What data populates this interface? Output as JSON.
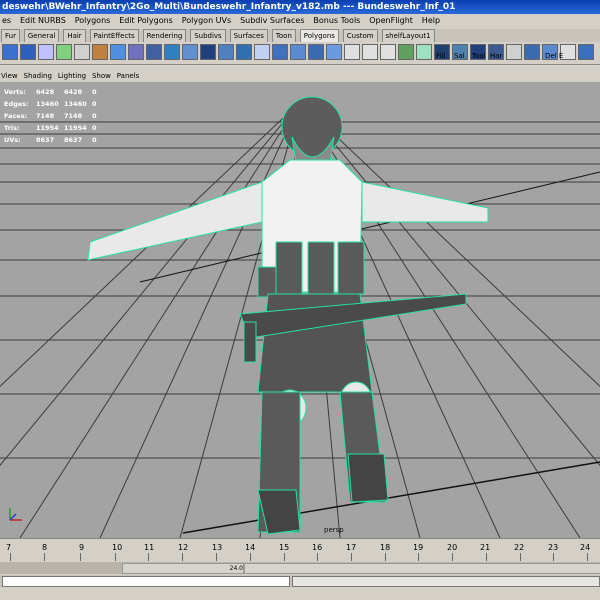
{
  "window": {
    "title": "deswehr\\BWehr_Infantry\\2Go_Multi\\Bundeswehr_Infantry_v182.mb  ---  Bundeswehr_Inf_01"
  },
  "menu": [
    "es",
    "Edit NURBS",
    "Polygons",
    "Edit Polygons",
    "Polygon UVs",
    "Subdiv Surfaces",
    "Bonus Tools",
    "OpenFlight",
    "Help"
  ],
  "shelf_tabs": [
    "Fur",
    "General",
    "Hair",
    "PaintEffects",
    "Rendering",
    "Subdivs",
    "Surfaces",
    "Toon",
    "Polygons",
    "Custom",
    "shelfLayout1"
  ],
  "shelf_labels": [
    "Fill",
    "Sal",
    "Tool",
    "Har",
    "Del E"
  ],
  "view_menu": [
    "View",
    "Shading",
    "Lighting",
    "Show",
    "Panels"
  ],
  "hud": {
    "rows": [
      {
        "label": "Verts:",
        "a": "6428",
        "b": "6428",
        "c": "0"
      },
      {
        "label": "Edges:",
        "a": "13460",
        "b": "13460",
        "c": "0"
      },
      {
        "label": "Faces:",
        "a": "7148",
        "b": "7148",
        "c": "0"
      },
      {
        "label": "Tris:",
        "a": "11954",
        "b": "11954",
        "c": "0"
      },
      {
        "label": "UVs:",
        "a": "8637",
        "b": "8637",
        "c": "0"
      }
    ]
  },
  "camera_label": "persp",
  "timeline": {
    "ticks": [
      "7",
      "8",
      "9",
      "10",
      "11",
      "12",
      "13",
      "14",
      "15",
      "16",
      "17",
      "18",
      "19",
      "20",
      "21",
      "22",
      "23",
      "24"
    ]
  },
  "range_value": "24.0",
  "colors": {
    "wire": "#1fd6a0",
    "viewport": "#a3a3a3",
    "title": "#0a3fb0"
  }
}
